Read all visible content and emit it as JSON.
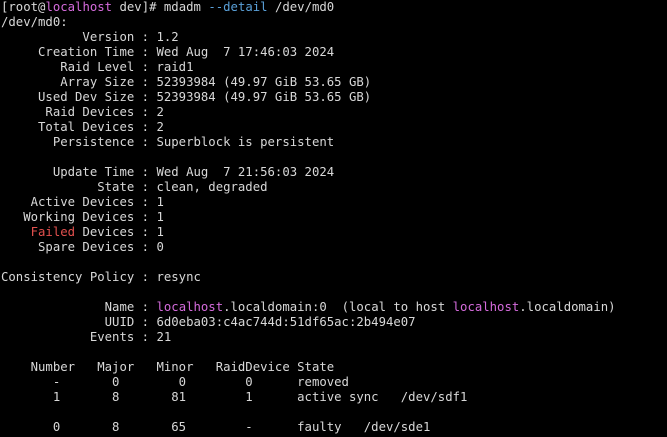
{
  "prompt": {
    "open": "[",
    "user": "root@",
    "host": "localhost",
    "cwd": " dev]# ",
    "cmd": "mdadm ",
    "opt": "--detail",
    "arg": " /dev/md0"
  },
  "device_header": "/dev/md0:",
  "fields": {
    "version": "           Version : 1.2",
    "creation_time": "     Creation Time : Wed Aug  7 17:46:03 2024",
    "raid_level": "        Raid Level : raid1",
    "array_size": "        Array Size : 52393984 (49.97 GiB 53.65 GB)",
    "used_dev_size": "     Used Dev Size : 52393984 (49.97 GiB 53.65 GB)",
    "raid_devices": "      Raid Devices : 2",
    "total_devices": "     Total Devices : 2",
    "persistence": "       Persistence : Superblock is persistent",
    "update_time": "       Update Time : Wed Aug  7 21:56:03 2024",
    "state": "             State : clean, degraded",
    "active_devices": "    Active Devices : 1",
    "working_devices": "   Working Devices : 1",
    "failed_prefix": "    ",
    "failed_word": "Failed",
    "failed_rest": " Devices : 1",
    "spare_devices": "     Spare Devices : 0",
    "consistency_policy": "Consistency Policy : resync",
    "name_prefix": "              Name : ",
    "name_host1": "localhost",
    "name_mid": ".localdomain:0  (local to host ",
    "name_host2": "localhost",
    "name_end": ".localdomain)",
    "uuid": "              UUID : 6d0eba03:c4ac744d:51df65ac:2b494e07",
    "events": "            Events : 21"
  },
  "table": {
    "header": "    Number   Major   Minor   RaidDevice State",
    "rows": [
      "       -       0        0        0      removed",
      "       1       8       81        1      active sync   /dev/sdf1",
      "       0       8       65        -      faulty   /dev/sde1"
    ]
  }
}
